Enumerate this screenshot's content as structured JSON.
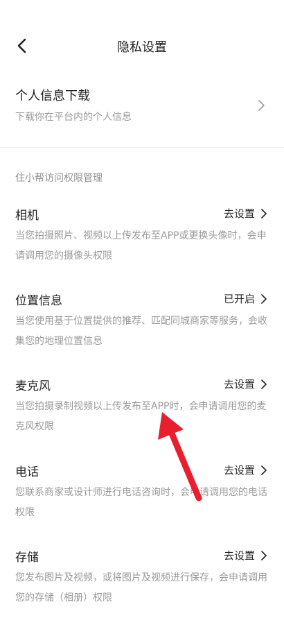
{
  "header": {
    "back_icon": "chevron-left-icon",
    "title": "隐私设置"
  },
  "download": {
    "title": "个人信息下载",
    "subtitle": "下载你在平台内的个人信息",
    "chevron_icon": "chevron-right-icon"
  },
  "section": {
    "label": "住小帮访问权限管理"
  },
  "permissions": [
    {
      "title": "相机",
      "action": "去设置",
      "desc": "当您拍摄照片、视频以上传发布至APP或更换头像时，会申请调用您的摄像头权限"
    },
    {
      "title": "位置信息",
      "action": "已开启",
      "desc": "当您使用基于位置提供的推荐、匹配同城商家等服务，会收集您的地理位置信息"
    },
    {
      "title": "麦克风",
      "action": "去设置",
      "desc": "当您拍摄录制视频以上传发布至APP时，会申请调用您的麦克风权限"
    },
    {
      "title": "电话",
      "action": "去设置",
      "desc": "您联系商家或设计师进行电话咨询时，会申请调用您的电话权限"
    },
    {
      "title": "存储",
      "action": "去设置",
      "desc": "您发布图片及视频，或将图片及视频进行保存，会申请调用您的存储（相册）权限"
    }
  ],
  "annotation": {
    "arrow_icon": "red-arrow-icon",
    "color": "#e8202e"
  },
  "colors": {
    "text_primary": "#1f1f1f",
    "text_secondary": "#9a9a9a",
    "divider": "#efefef"
  }
}
